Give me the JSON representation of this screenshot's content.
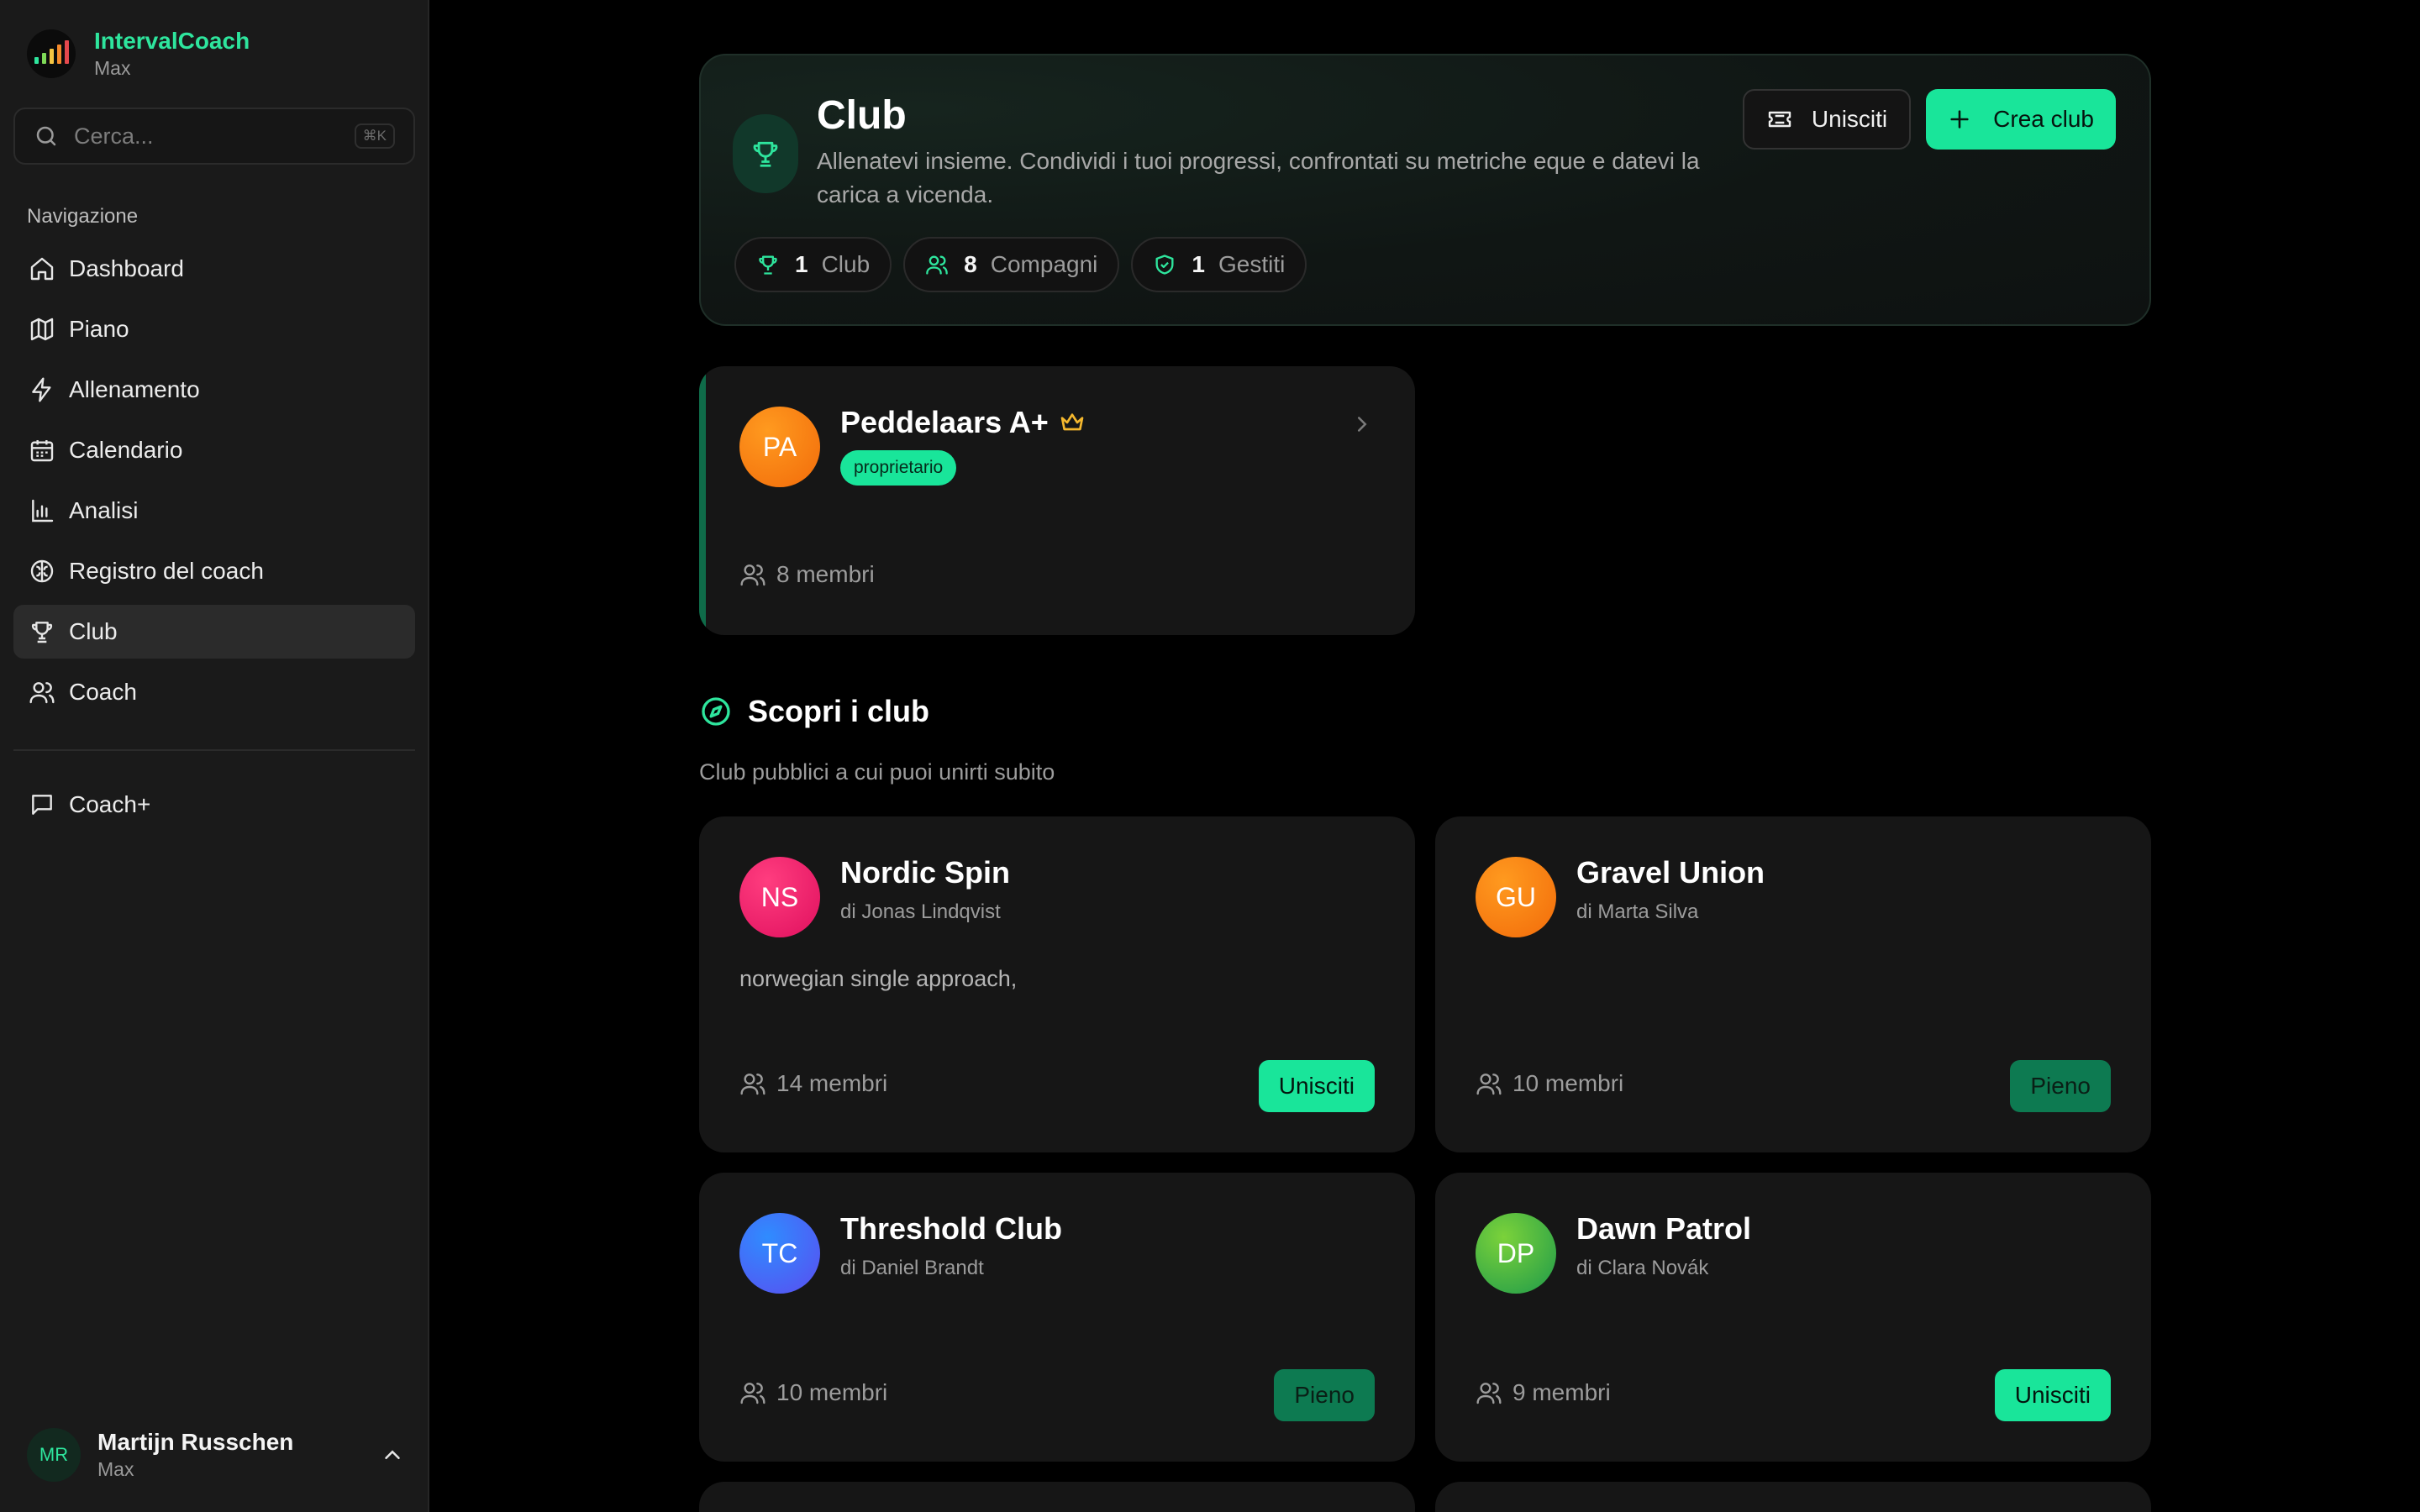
{
  "app": {
    "name": "IntervalCoach",
    "subtitle": "Max"
  },
  "search": {
    "placeholder": "Cerca...",
    "shortcut": "⌘K"
  },
  "nav": {
    "heading": "Navigazione",
    "items": [
      {
        "label": "Dashboard",
        "icon": "home-icon"
      },
      {
        "label": "Piano",
        "icon": "map-icon"
      },
      {
        "label": "Allenamento",
        "icon": "bolt-icon"
      },
      {
        "label": "Calendario",
        "icon": "calendar-icon"
      },
      {
        "label": "Analisi",
        "icon": "bar-chart-icon"
      },
      {
        "label": "Registro del coach",
        "icon": "brain-icon"
      },
      {
        "label": "Club",
        "icon": "trophy-icon",
        "active": true
      },
      {
        "label": "Coach",
        "icon": "users-icon"
      }
    ],
    "extra": [
      {
        "label": "Coach+",
        "icon": "chat-icon"
      }
    ]
  },
  "user": {
    "initials": "MR",
    "name": "Martijn Russchen",
    "subtitle": "Max"
  },
  "hero": {
    "title": "Club",
    "description": "Allenatevi insieme. Condividi i tuoi progressi, confrontati su metriche eque e datevi la carica a vicenda.",
    "join_label": "Unisciti",
    "create_label": "Crea club",
    "stats": [
      {
        "value": "1",
        "label": "Club",
        "icon": "trophy-icon"
      },
      {
        "value": "8",
        "label": "Compagni",
        "icon": "users-icon"
      },
      {
        "value": "1",
        "label": "Gestiti",
        "icon": "shield-check-icon"
      }
    ]
  },
  "my_club": {
    "initials": "PA",
    "name": "Peddelaars A+",
    "role": "proprietario",
    "members": "8 membri"
  },
  "discover": {
    "title": "Scopri i club",
    "subtitle": "Club pubblici a cui puoi unirti subito",
    "clubs": [
      {
        "initials": "NS",
        "name": "Nordic Spin",
        "owner": "di Jonas Lindqvist",
        "description": "norwegian single approach,",
        "members": "14 membri",
        "action": "Unisciti",
        "status": "join"
      },
      {
        "initials": "GU",
        "name": "Gravel Union",
        "owner": "di Marta Silva",
        "description": "",
        "members": "10 membri",
        "action": "Pieno",
        "status": "full"
      },
      {
        "initials": "TC",
        "name": "Threshold Club",
        "owner": "di Daniel Brandt",
        "description": "",
        "members": "10 membri",
        "action": "Pieno",
        "status": "full"
      },
      {
        "initials": "DP",
        "name": "Dawn Patrol",
        "owner": "di Clara Novák",
        "description": "",
        "members": "9 membri",
        "action": "Unisciti",
        "status": "join"
      }
    ]
  },
  "colors": {
    "accent": "#19e59a",
    "accent_dark": "#0d7a51",
    "sidebar_bg": "#1a1a1a",
    "card_bg": "#161616"
  }
}
